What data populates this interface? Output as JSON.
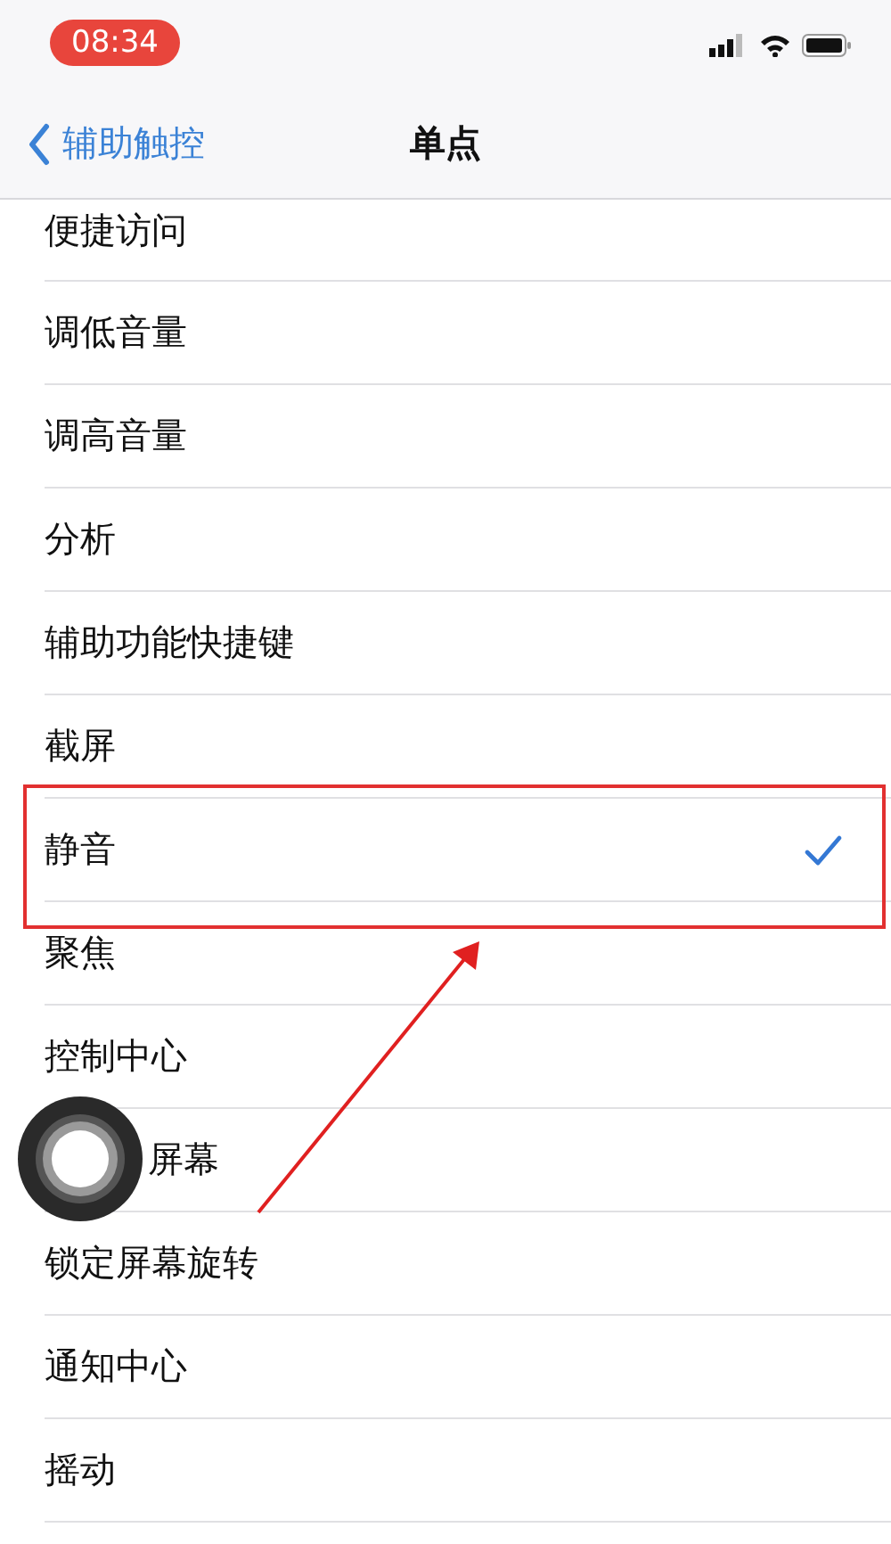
{
  "status_bar": {
    "time": "08:34"
  },
  "nav_bar": {
    "back_label": "辅助触控",
    "title": "单点"
  },
  "items": [
    {
      "label": "便捷访问",
      "selected": false,
      "highlighted": false,
      "covered": false
    },
    {
      "label": "调低音量",
      "selected": false,
      "highlighted": false,
      "covered": false
    },
    {
      "label": "调高音量",
      "selected": false,
      "highlighted": false,
      "covered": false
    },
    {
      "label": "分析",
      "selected": false,
      "highlighted": false,
      "covered": false
    },
    {
      "label": "辅助功能快捷键",
      "selected": false,
      "highlighted": false,
      "covered": false
    },
    {
      "label": "截屏",
      "selected": false,
      "highlighted": false,
      "covered": false
    },
    {
      "label": "静音",
      "selected": true,
      "highlighted": true,
      "covered": false
    },
    {
      "label": "聚焦",
      "selected": false,
      "highlighted": false,
      "covered": false
    },
    {
      "label": "控制中心",
      "selected": false,
      "highlighted": false,
      "covered": false
    },
    {
      "label": "屏幕",
      "selected": false,
      "highlighted": false,
      "covered": true
    },
    {
      "label": "锁定屏幕旋转",
      "selected": false,
      "highlighted": false,
      "covered": false
    },
    {
      "label": "通知中心",
      "selected": false,
      "highlighted": false,
      "covered": false
    },
    {
      "label": "摇动",
      "selected": false,
      "highlighted": false,
      "covered": false
    }
  ]
}
